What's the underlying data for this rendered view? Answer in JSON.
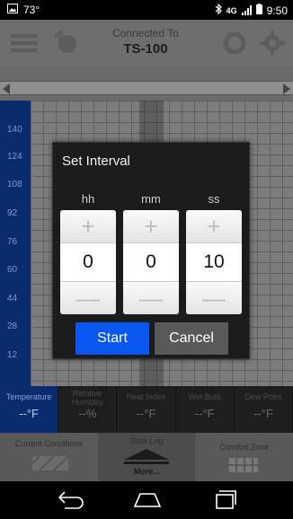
{
  "statusbar": {
    "notification_icon": "image-notification-icon",
    "temperature": "73°",
    "clock": "9:50",
    "network": "4G"
  },
  "header": {
    "title": "Connected To",
    "device": "TS-100"
  },
  "chart": {
    "y_ticks": [
      "140",
      "124",
      "108",
      "92",
      "76",
      "60",
      "44",
      "28",
      "12"
    ]
  },
  "readings": [
    {
      "label": "Temperature",
      "value": "--°F"
    },
    {
      "label": "Relative Humidity",
      "value": "--%"
    },
    {
      "label": "Heat Index",
      "value": "--°F"
    },
    {
      "label": "Wet Bulb",
      "value": "--°F"
    },
    {
      "label": "Dew Point",
      "value": "--°F"
    }
  ],
  "tabs": {
    "left": "Current Conditions",
    "middle": "Data Log",
    "middle_more": "More...",
    "right": "Comfort Zone"
  },
  "dialog": {
    "title": "Set Interval",
    "columns": [
      {
        "label": "hh",
        "value": "0"
      },
      {
        "label": "mm",
        "value": "0"
      },
      {
        "label": "ss",
        "value": "10"
      }
    ],
    "plus": "+",
    "minus": "—",
    "start": "Start",
    "cancel": "Cancel"
  },
  "colors": {
    "accent": "#0a56f0",
    "axis_blue": "#0a2b6e",
    "dialog_bg": "#1b1b1b"
  }
}
